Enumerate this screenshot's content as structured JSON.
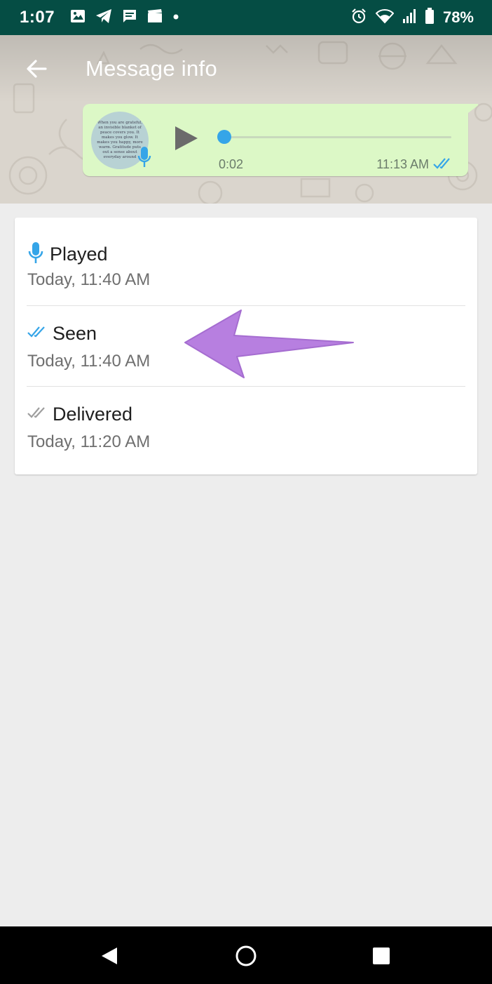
{
  "status_bar": {
    "time": "1:07",
    "battery_percent": "78%"
  },
  "app_bar": {
    "title": "Message info"
  },
  "voice_message": {
    "duration": "0:02",
    "sent_time": "11:13 AM",
    "thumbnail_text": "When you are grateful, an invisible blanket of peace covers you. It makes you glow. It makes you happy, more warm. Gratitude puts out a sense about everyday around",
    "progress": 0.0
  },
  "receipts": [
    {
      "icon": "mic-icon",
      "label": "Played",
      "time": "Today, 11:40 AM"
    },
    {
      "icon": "double-check-blue-icon",
      "label": "Seen",
      "time": "Today, 11:40 AM"
    },
    {
      "icon": "double-check-gray-icon",
      "label": "Delivered",
      "time": "Today, 11:20 AM"
    }
  ],
  "colors": {
    "status_bar": "#054d44",
    "bubble": "#dcf8c6",
    "accent_blue": "#35a5e8",
    "annotation_arrow": "#b77fe0"
  }
}
